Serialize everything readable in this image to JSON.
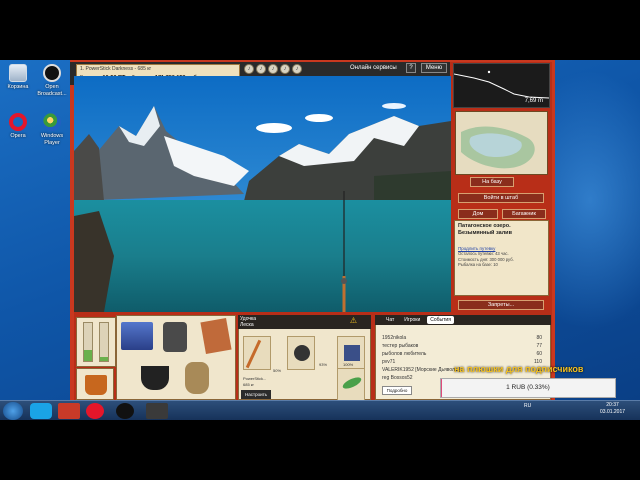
{
  "desktop": {
    "icons": [
      {
        "label": "Корзина",
        "icon": "recycle-bin-icon"
      },
      {
        "label": "Open Broadcast...",
        "icon": "obs-icon"
      },
      {
        "label": "Opera",
        "icon": "opera-icon"
      },
      {
        "label": "Windows Player",
        "icon": "media-player-icon"
      }
    ]
  },
  "game": {
    "info": {
      "tackle": "1. PowerStick Darkness - 685 кг",
      "time_label": "Время:",
      "time_value": "16:50 ПТ",
      "money_label": "Деньги:",
      "money_value": "171 786 158 руб."
    },
    "top": {
      "services": "Онлайн сервисы",
      "help": "?",
      "menu": "Меню"
    },
    "depth": "7,69 m",
    "nav": {
      "base": "На базу",
      "hq": "Войти в штаб",
      "house": "Дом",
      "baggage": "Багажник",
      "bans": "Запреты..."
    },
    "location": {
      "title": "Патагонское озеро. Безымянный залив",
      "link": "Продлить путевку",
      "line1": "Осталось путевки: 43 час.",
      "line2": "Стоимость дня: 300 000 руб.",
      "line3": "Рыбалка на базе: 10"
    },
    "tackle_panel": {
      "tab1": "Удочка",
      "tab2": "Леска",
      "rod_name": "PowerStick...",
      "rod_weight": "685 кг",
      "pct1": "50%",
      "pct2": "93%",
      "pct3": "100%",
      "setup": "Настроить"
    },
    "chat": {
      "tabs": [
        "Чат",
        "Игроки",
        "События"
      ],
      "active_tab": "События",
      "rows": [
        {
          "name": "1952nikola",
          "value": "80"
        },
        {
          "name": "тестер рыбаков",
          "value": "77"
        },
        {
          "name": "рыболов любитель",
          "value": "60"
        },
        {
          "name": "pvv71",
          "value": "110"
        },
        {
          "name": "VALERIK1952 [Морские Дьяволы]",
          "value": "11"
        },
        {
          "name": "reg Bossos52",
          "value": ""
        }
      ],
      "detail": "Подробно"
    }
  },
  "overlay": {
    "donate_text": "на плюшки для подписчиков",
    "progress_text": "1 RUB (0.33%)",
    "progress_pct": 0.33
  },
  "taskbar": {
    "lang": "RU",
    "time": "20:37",
    "date": "03.01.2017"
  },
  "colors": {
    "frame": "#b82e18",
    "panel": "#f0e6cc",
    "accent": "#f3c020"
  }
}
